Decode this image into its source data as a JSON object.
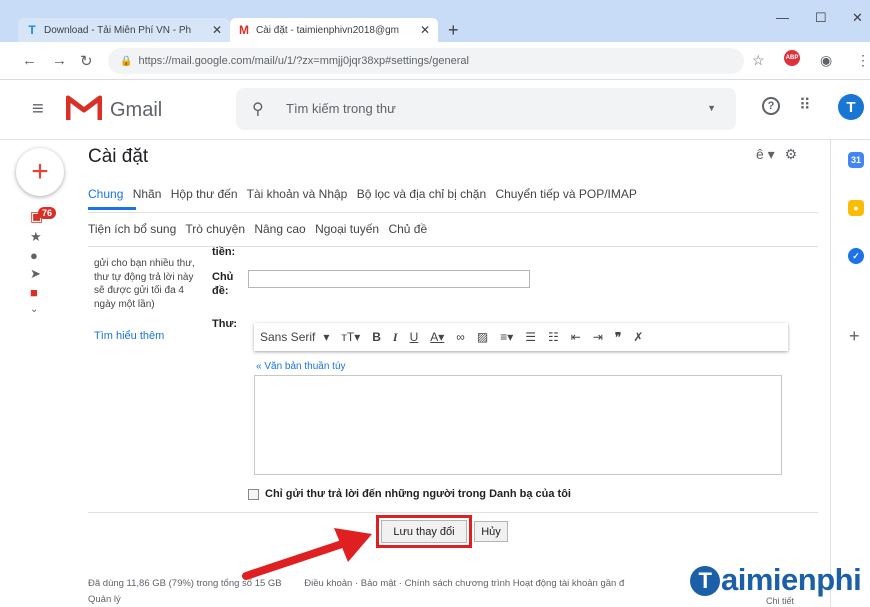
{
  "browser": {
    "tabs": [
      {
        "title": "Download - Tải Miễn Phí VN - Ph",
        "favicon": "T",
        "favicon_color": "#1e88e5"
      },
      {
        "title": "Cài đặt - taimienphivn2018@gm",
        "favicon": "M",
        "favicon_color": "#d93025"
      }
    ],
    "new_tab": "+",
    "url": "https://mail.google.com/mail/u/1/?zx=mmjj0jqr38xp#settings/general"
  },
  "gmail": {
    "app_name": "Gmail",
    "search_placeholder": "Tìm kiếm trong thư",
    "avatar_letter": "T",
    "unread_count": "76"
  },
  "settings": {
    "title": "Cài đặt",
    "tabs_row1": [
      "Chung",
      "Nhãn",
      "Hộp thư đến",
      "Tài khoản và Nhập",
      "Bộ lọc và địa chỉ bị chặn",
      "Chuyển tiếp và POP/IMAP"
    ],
    "tabs_row2": [
      "Tiện ích bổ sung",
      "Trò chuyện",
      "Nâng cao",
      "Ngoại tuyến",
      "Chủ đề"
    ],
    "left_text": "gửi cho bạn nhiều thư, thư tự động trả lời này sẽ được gửi tối đa 4 ngày một lần)",
    "learn_more": "Tìm hiểu thêm",
    "label_top": "tiền:",
    "label_subject": "Chủ đề:",
    "label_body": "Thư:",
    "font_name": "Sans Serif",
    "plain_text_link": "« Văn bản thuần túy",
    "checkbox_label": "Chỉ gửi thư trả lời đến những người trong Danh bạ của tôi",
    "save_button": "Lưu thay đổi",
    "cancel_button": "Hủy"
  },
  "footer": {
    "storage": "Đã dùng 11,86 GB (79%) trong tổng số 15 GB",
    "links": "Điều khoản · Bảo mật · Chính sách chương trình    Hoạt động tài khoản gần đ",
    "manage": "Quản lý",
    "details": "Chi tiết"
  },
  "watermark": {
    "letter": "T",
    "text": "aimienphi"
  },
  "colors": {
    "accent": "#1a73e8",
    "highlight": "#e02020"
  }
}
